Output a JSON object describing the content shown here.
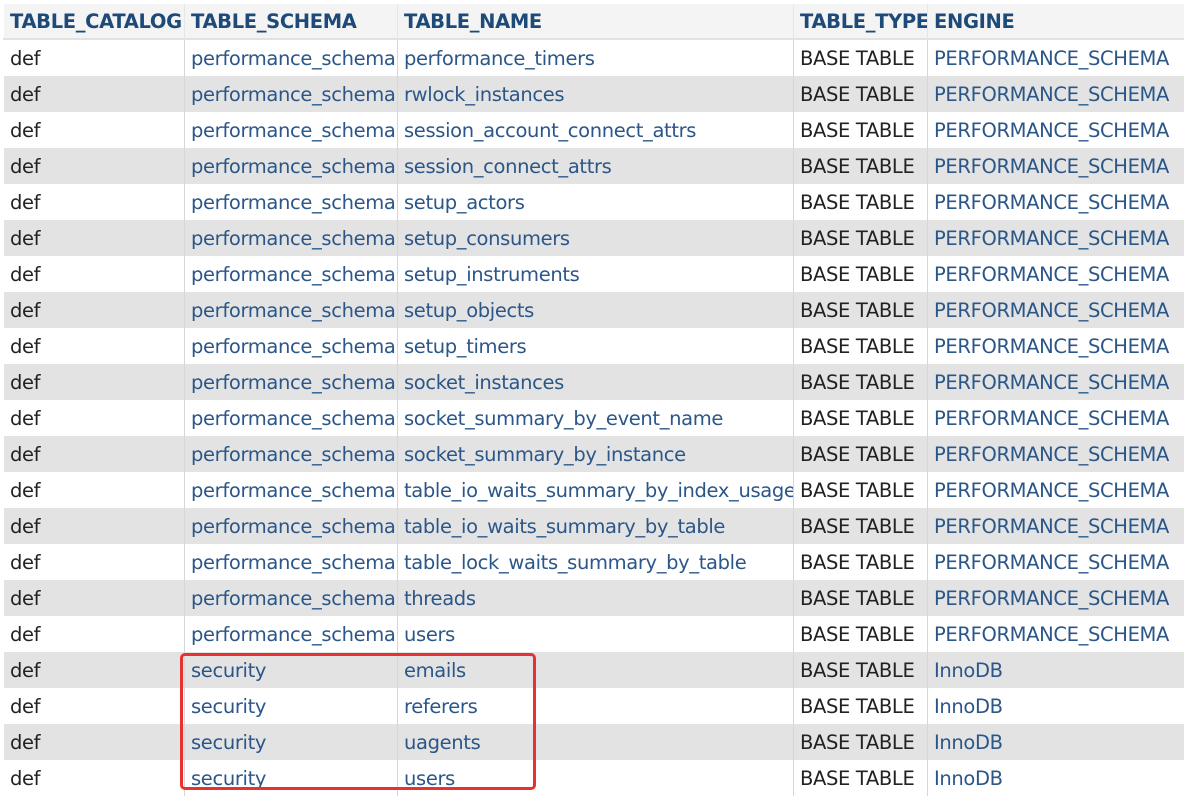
{
  "columns": [
    "TABLE_CATALOG",
    "TABLE_SCHEMA",
    "TABLE_NAME",
    "TABLE_TYPE",
    "ENGINE"
  ],
  "rows": [
    [
      "def",
      "performance_schema",
      "performance_timers",
      "BASE TABLE",
      "PERFORMANCE_SCHEMA"
    ],
    [
      "def",
      "performance_schema",
      "rwlock_instances",
      "BASE TABLE",
      "PERFORMANCE_SCHEMA"
    ],
    [
      "def",
      "performance_schema",
      "session_account_connect_attrs",
      "BASE TABLE",
      "PERFORMANCE_SCHEMA"
    ],
    [
      "def",
      "performance_schema",
      "session_connect_attrs",
      "BASE TABLE",
      "PERFORMANCE_SCHEMA"
    ],
    [
      "def",
      "performance_schema",
      "setup_actors",
      "BASE TABLE",
      "PERFORMANCE_SCHEMA"
    ],
    [
      "def",
      "performance_schema",
      "setup_consumers",
      "BASE TABLE",
      "PERFORMANCE_SCHEMA"
    ],
    [
      "def",
      "performance_schema",
      "setup_instruments",
      "BASE TABLE",
      "PERFORMANCE_SCHEMA"
    ],
    [
      "def",
      "performance_schema",
      "setup_objects",
      "BASE TABLE",
      "PERFORMANCE_SCHEMA"
    ],
    [
      "def",
      "performance_schema",
      "setup_timers",
      "BASE TABLE",
      "PERFORMANCE_SCHEMA"
    ],
    [
      "def",
      "performance_schema",
      "socket_instances",
      "BASE TABLE",
      "PERFORMANCE_SCHEMA"
    ],
    [
      "def",
      "performance_schema",
      "socket_summary_by_event_name",
      "BASE TABLE",
      "PERFORMANCE_SCHEMA"
    ],
    [
      "def",
      "performance_schema",
      "socket_summary_by_instance",
      "BASE TABLE",
      "PERFORMANCE_SCHEMA"
    ],
    [
      "def",
      "performance_schema",
      "table_io_waits_summary_by_index_usage",
      "BASE TABLE",
      "PERFORMANCE_SCHEMA"
    ],
    [
      "def",
      "performance_schema",
      "table_io_waits_summary_by_table",
      "BASE TABLE",
      "PERFORMANCE_SCHEMA"
    ],
    [
      "def",
      "performance_schema",
      "table_lock_waits_summary_by_table",
      "BASE TABLE",
      "PERFORMANCE_SCHEMA"
    ],
    [
      "def",
      "performance_schema",
      "threads",
      "BASE TABLE",
      "PERFORMANCE_SCHEMA"
    ],
    [
      "def",
      "performance_schema",
      "users",
      "BASE TABLE",
      "PERFORMANCE_SCHEMA"
    ],
    [
      "def",
      "security",
      "emails",
      "BASE TABLE",
      "InnoDB"
    ],
    [
      "def",
      "security",
      "referers",
      "BASE TABLE",
      "InnoDB"
    ],
    [
      "def",
      "security",
      "uagents",
      "BASE TABLE",
      "InnoDB"
    ],
    [
      "def",
      "security",
      "users",
      "BASE TABLE",
      "InnoDB"
    ]
  ],
  "colors": {
    "header_text": "#1d4a78",
    "link_text": "#2b5688",
    "plain_text": "#222222",
    "row_alt_bg": "#e3e3e3",
    "highlight_border": "#e53333"
  }
}
